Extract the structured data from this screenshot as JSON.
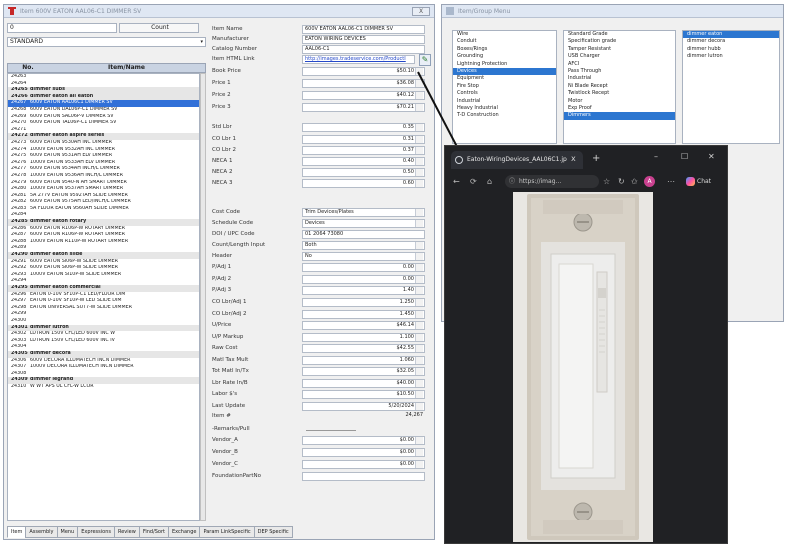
{
  "main_window": {
    "title": "Item 600V EATON AAL06-C1 DIMMER SV",
    "close_label": "X",
    "search": {
      "value": "0",
      "count_label": "Count"
    },
    "filter": {
      "value": "STANDARD"
    },
    "list_headers": {
      "no": "No.",
      "name": "Item/Name"
    },
    "items": [
      {
        "no": "24263",
        "name": "",
        "kind": "normal"
      },
      {
        "no": "24264",
        "name": "",
        "kind": "normal"
      },
      {
        "no": "24265",
        "name": "dimmer subs",
        "kind": "group"
      },
      {
        "no": "24266",
        "name": "dimmer eaton all eaton",
        "kind": "group"
      },
      {
        "no": "24267",
        "name": "600V EATON AAL06C1 DIMMER SV",
        "kind": "selected"
      },
      {
        "no": "24268",
        "name": "600V EATON DAL06P-C1 DIMMER SV",
        "kind": "normal"
      },
      {
        "no": "24269",
        "name": "600V EATON SAL06P-V DIMMER SV",
        "kind": "normal"
      },
      {
        "no": "24270",
        "name": "600V EATON TAL06P-C1 DIMMER SV",
        "kind": "normal"
      },
      {
        "no": "24271",
        "name": "",
        "kind": "normal"
      },
      {
        "no": "24272",
        "name": "dimmer eaton aspire series",
        "kind": "group"
      },
      {
        "no": "24273",
        "name": "600V EATON 9530AH INC DIMMER",
        "kind": "normal"
      },
      {
        "no": "24274",
        "name": "1000V EATON 9532AH INC DIMMER",
        "kind": "normal"
      },
      {
        "no": "24275",
        "name": "600V EATON 9531AH ELV DIMMER",
        "kind": "normal"
      },
      {
        "no": "24276",
        "name": "1000V EATON 9533AH ELV DIMMER",
        "kind": "normal"
      },
      {
        "no": "24277",
        "name": "600V EATON 9534AH INCH/L DIMMER",
        "kind": "normal"
      },
      {
        "no": "24278",
        "name": "1000V EATON 9536AH INCH/L DIMMER",
        "kind": "normal"
      },
      {
        "no": "24279",
        "name": "600V EATON 9540-N AH SMART DIMMER",
        "kind": "normal"
      },
      {
        "no": "24280",
        "name": "1000V EATON 9537AH SMART DIMMER",
        "kind": "normal"
      },
      {
        "no": "24281",
        "name": "5A 277V EATON 9592TAH SLIDE DIMMER",
        "kind": "normal"
      },
      {
        "no": "24282",
        "name": "600V EATON 9575AH LED/INCH/L DIMMER",
        "kind": "normal"
      },
      {
        "no": "24283",
        "name": "5A FLUOR EATON 9560AH SLIDE DIMMER",
        "kind": "normal"
      },
      {
        "no": "24284",
        "name": "",
        "kind": "normal"
      },
      {
        "no": "24285",
        "name": "dimmer eaton rotary",
        "kind": "group"
      },
      {
        "no": "24286",
        "name": "600V EATON R106P-W ROTARY DIMMER",
        "kind": "normal"
      },
      {
        "no": "24287",
        "name": "600V EATON R106P-W ROTARY DIMMER",
        "kind": "normal"
      },
      {
        "no": "24288",
        "name": "1000V EATON R110P-W ROTARY DIMMER",
        "kind": "normal"
      },
      {
        "no": "24289",
        "name": "",
        "kind": "normal"
      },
      {
        "no": "24290",
        "name": "dimmer eaton slide",
        "kind": "group"
      },
      {
        "no": "24291",
        "name": "600V EATON SI06P-W SLIDE DIMMER",
        "kind": "normal"
      },
      {
        "no": "24292",
        "name": "600V EATON SI06P-W SLIDE DIMMER",
        "kind": "normal"
      },
      {
        "no": "24293",
        "name": "1000V EATON SI10P-W SLIDE DIMMER",
        "kind": "normal"
      },
      {
        "no": "24294",
        "name": "",
        "kind": "normal"
      },
      {
        "no": "24295",
        "name": "dimmer eaton commercial",
        "kind": "group"
      },
      {
        "no": "24296",
        "name": "EATON 0-10V SF10P-C1 LED/FLUOR DIM",
        "kind": "normal"
      },
      {
        "no": "24297",
        "name": "EATON 0-10V SF10P-W LED SLIDE DIM",
        "kind": "normal"
      },
      {
        "no": "24298",
        "name": "EATON UNIVERSAL SUT7-W SLIDE DIMMER",
        "kind": "normal"
      },
      {
        "no": "24299",
        "name": "",
        "kind": "normal"
      },
      {
        "no": "24300",
        "name": "",
        "kind": "normal"
      },
      {
        "no": "24301",
        "name": "dimmer lutron",
        "kind": "group"
      },
      {
        "no": "24302",
        "name": "LUTRON 150V CFL/LED 600V INC W",
        "kind": "normal"
      },
      {
        "no": "24303",
        "name": "LUTRON 150V CFL/LED 600V INC IV",
        "kind": "normal"
      },
      {
        "no": "24304",
        "name": "",
        "kind": "normal"
      },
      {
        "no": "24305",
        "name": "dimmer decora",
        "kind": "group"
      },
      {
        "no": "24306",
        "name": "600V DECORA ILLUMATECH INCN DIMMER",
        "kind": "normal"
      },
      {
        "no": "24307",
        "name": "1000V DECORA ILLUMATECH INCN DIMMER",
        "kind": "normal"
      },
      {
        "no": "24308",
        "name": "",
        "kind": "normal"
      },
      {
        "no": "24309",
        "name": "dimmer legrand",
        "kind": "group"
      },
      {
        "no": "24310",
        "name": "W WT APS UL CFL-W LCOR",
        "kind": "normal"
      }
    ],
    "fields": [
      {
        "label": "Item Name",
        "value": "600V EATON AAL06-C1 DIMMER SV",
        "type": "text"
      },
      {
        "label": "Manufacturer",
        "value": "EATON WIRING DEVICES",
        "type": "text"
      },
      {
        "label": "Catalog Number",
        "value": "AAL06-C1",
        "type": "text"
      },
      {
        "label": "Item HTML Link",
        "value": "http://images.tradeservice.com/ProductI",
        "type": "link"
      },
      {
        "label": "Book Price",
        "value": "$50.10",
        "type": "num"
      },
      {
        "label": "Price 1",
        "value": "$36.08",
        "type": "num"
      },
      {
        "label": "Price 2",
        "value": "$40.12",
        "type": "num"
      },
      {
        "label": "Price 3",
        "value": "$70.21",
        "type": "num"
      },
      {
        "label": "Std Lbr",
        "value": "0.35",
        "type": "num"
      },
      {
        "label": "CO Lbr 1",
        "value": "0.31",
        "type": "num"
      },
      {
        "label": "CO Lbr 2",
        "value": "0.37",
        "type": "num"
      },
      {
        "label": "NECA 1",
        "value": "0.40",
        "type": "num"
      },
      {
        "label": "NECA 2",
        "value": "0.50",
        "type": "num"
      },
      {
        "label": "NECA 3",
        "value": "0.60",
        "type": "num"
      },
      {
        "label": "Cost Code",
        "value": "Trim Devices/Plates",
        "type": "dd"
      },
      {
        "label": "Schedule Code",
        "value": "Devices",
        "type": "dd"
      },
      {
        "label": "DOI / UPC Code",
        "value": "01 2064 73080",
        "type": "text"
      },
      {
        "label": "Count/Length Input",
        "value": "Both",
        "type": "dd"
      },
      {
        "label": "Header",
        "value": "No",
        "type": "dd"
      },
      {
        "label": "P/Adj 1",
        "value": "0.00",
        "type": "num"
      },
      {
        "label": "P/Adj 2",
        "value": "0.00",
        "type": "num"
      },
      {
        "label": "P/Adj 3",
        "value": "1.40",
        "type": "num"
      },
      {
        "label": "CO Lbr/Adj 1",
        "value": "1.250",
        "type": "num"
      },
      {
        "label": "CO Lbr/Adj 2",
        "value": "1.450",
        "type": "num"
      },
      {
        "label": "U/Price",
        "value": "$46.14",
        "type": "num"
      },
      {
        "label": "U/P Markup",
        "value": "1.100",
        "type": "num"
      },
      {
        "label": "Raw Cost",
        "value": "$42.55",
        "type": "num"
      },
      {
        "label": "Matl Tax Mult",
        "value": "1.060",
        "type": "num"
      },
      {
        "label": "Tot Matl In/Tx",
        "value": "$32.05",
        "type": "num"
      },
      {
        "label": "Lbr Rate In/B",
        "value": "$40.00",
        "type": "num"
      },
      {
        "label": "Labor $'s",
        "value": "$10.50",
        "type": "num"
      },
      {
        "label": "Last Update",
        "value": "5/20/2024",
        "type": "num"
      },
      {
        "label": "Item #",
        "value": "24,267",
        "type": "plain"
      },
      {
        "label": "-Remarks/Pull",
        "value": "",
        "type": "line"
      },
      {
        "label": "Vendor_A",
        "value": "$0.00",
        "type": "num"
      },
      {
        "label": "Vendor_B",
        "value": "$0.00",
        "type": "num"
      },
      {
        "label": "Vendor_C",
        "value": "$0.00",
        "type": "num"
      },
      {
        "label": "FoundationPartNo",
        "value": "",
        "type": "text"
      }
    ],
    "tabs": [
      "Item",
      "Assembly",
      "Menu",
      "Expressions",
      "Review",
      "Find/Sort",
      "Exchange",
      "Param LinkSpecific",
      "DEP Specific"
    ],
    "active_tab": 0
  },
  "category_window": {
    "title": "Item/Group Menu",
    "col1": [
      "Wire",
      "Conduit",
      "Boxes/Rings",
      "Grounding",
      "Lightning Protection",
      "Devices",
      "Equipment",
      "Fire Stop",
      "Controls",
      "Industrial",
      "Heavy Industrial",
      "T-D Construction"
    ],
    "col1_selected": 5,
    "col2": [
      "Standard Grade",
      "Specification grade",
      "Tamper Resistant",
      "USB Charger",
      "AFCI",
      "Pass Through",
      "Industrial",
      "Ni Blade Recept",
      "Twistlock Recept",
      "Motor",
      "Exp Proof",
      "Dimmers"
    ],
    "col2_selected": 11,
    "col3": [
      "dimmer eaton",
      "dimmer decora",
      "dimmer hubb",
      "dimmer lutron"
    ],
    "col3_selected": 0
  },
  "browser": {
    "tab_title": "Eaton-WiringDevices_AAL06C1.jp",
    "tab_close": "x",
    "new_tab": "+",
    "address": "https://imag...",
    "avatar_letter": "A",
    "chat_label": "Chat",
    "win_controls": [
      "–",
      "☐",
      "✕"
    ]
  }
}
